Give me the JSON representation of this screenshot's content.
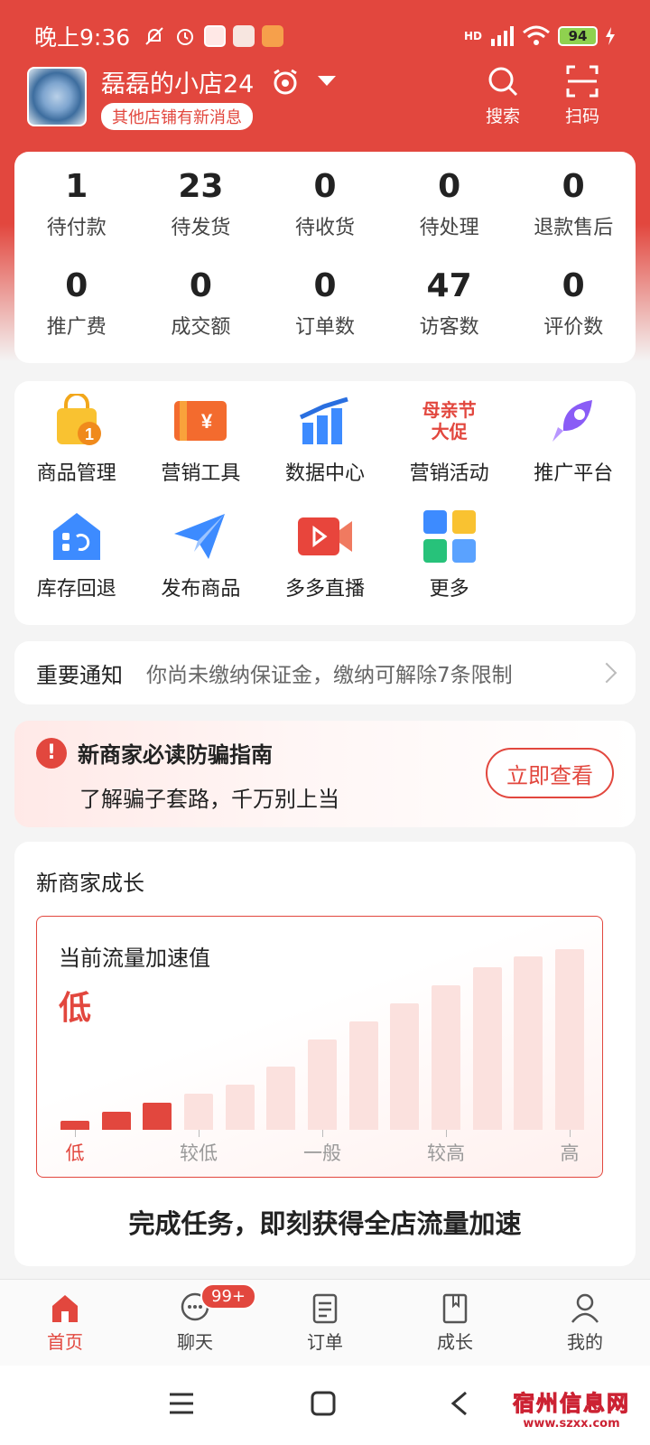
{
  "status_bar": {
    "time": "晚上9:36",
    "battery": "94",
    "network_tag": "HD"
  },
  "shop": {
    "name": "磊磊的小店24",
    "news_pill": "其他店铺有新消息"
  },
  "header_actions": {
    "search_label": "搜索",
    "scan_label": "扫码"
  },
  "stats": [
    {
      "value": "1",
      "label": "待付款"
    },
    {
      "value": "23",
      "label": "待发货"
    },
    {
      "value": "0",
      "label": "待收货"
    },
    {
      "value": "0",
      "label": "待处理"
    },
    {
      "value": "0",
      "label": "退款售后"
    },
    {
      "value": "0",
      "label": "推广费"
    },
    {
      "value": "0",
      "label": "成交额"
    },
    {
      "value": "0",
      "label": "订单数"
    },
    {
      "value": "47",
      "label": "访客数"
    },
    {
      "value": "0",
      "label": "评价数"
    }
  ],
  "tools": [
    {
      "label": "商品管理",
      "icon": "product-bag-icon",
      "badge": "1"
    },
    {
      "label": "营销工具",
      "icon": "coupon-icon"
    },
    {
      "label": "数据中心",
      "icon": "bar-chart-icon"
    },
    {
      "label": "营销活动",
      "icon": "promo-text-icon",
      "promo_line1": "母亲节",
      "promo_line2": "大促"
    },
    {
      "label": "推广平台",
      "icon": "rocket-icon"
    },
    {
      "label": "库存回退",
      "icon": "warehouse-return-icon"
    },
    {
      "label": "发布商品",
      "icon": "paper-plane-icon"
    },
    {
      "label": "多多直播",
      "icon": "live-video-icon"
    },
    {
      "label": "更多",
      "icon": "more-apps-icon"
    }
  ],
  "notice": {
    "title": "重要通知",
    "text": "你尚未缴纳保证金，缴纳可解除7条限制"
  },
  "guide": {
    "title": "新商家必读防骗指南",
    "subtitle": "了解骗子套路，千万别上当",
    "button": "立即查看"
  },
  "growth": {
    "title": "新商家成长",
    "traffic_title": "当前流量加速值",
    "traffic_level": "低",
    "levels": [
      "低",
      "较低",
      "一般",
      "较高",
      "高"
    ],
    "active_level_index": 0,
    "bar_heights": [
      0.05,
      0.1,
      0.15,
      0.2,
      0.25,
      0.35,
      0.5,
      0.6,
      0.7,
      0.8,
      0.9,
      0.96,
      1.0
    ],
    "active_bars": 3,
    "tasks_title": "完成任务，即刻获得全店流量加速"
  },
  "tabs": [
    {
      "label": "首页",
      "icon": "home-icon",
      "active": true
    },
    {
      "label": "聊天",
      "icon": "chat-icon",
      "badge": "99+"
    },
    {
      "label": "订单",
      "icon": "order-icon"
    },
    {
      "label": "成长",
      "icon": "growth-book-icon"
    },
    {
      "label": "我的",
      "icon": "profile-icon"
    }
  ],
  "watermark": {
    "main": "宿州信息网",
    "sub": "www.szxx.com"
  },
  "colors": {
    "brand": "#e2473e",
    "background": "#f4f4f4"
  }
}
